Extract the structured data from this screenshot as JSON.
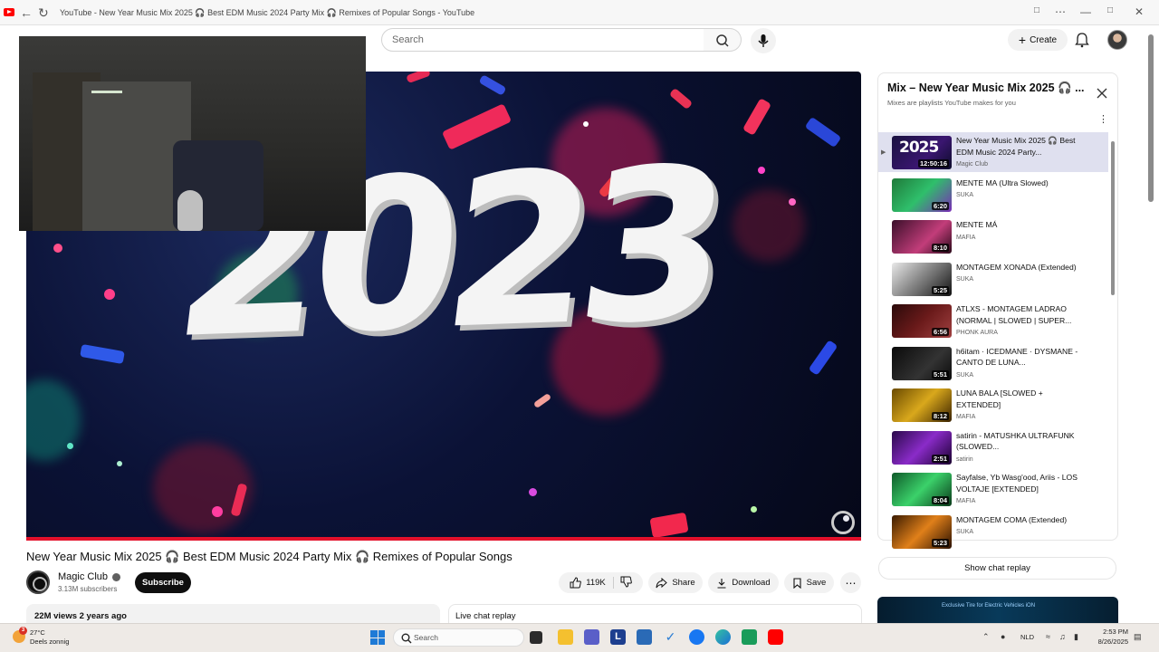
{
  "browser": {
    "tab_title": "YouTube - New Year Music Mix 2025 🎧 Best EDM Music 2024 Party Mix 🎧 Remixes of Popular Songs - YouTube"
  },
  "header": {
    "search_placeholder": "Search",
    "create_label": "Create"
  },
  "player": {
    "overlay_text": "2023",
    "progress": 1.0
  },
  "video": {
    "title": "New Year Music Mix 2025 🎧 Best EDM Music 2024 Party Mix 🎧 Remixes of Popular Songs",
    "channel": "Magic Club",
    "subscribers": "3.13M subscribers",
    "subscribe_label": "Subscribe",
    "likes": "119K",
    "share_label": "Share",
    "download_label": "Download",
    "save_label": "Save",
    "views_date": "22M views  2 years ago",
    "live_chat_label": "Live chat replay"
  },
  "playlist": {
    "title": "Mix – New Year Music Mix 2025 🎧 ...",
    "subtitle": "Mixes are playlists YouTube makes for you",
    "items": [
      {
        "title": "New Year Music Mix 2025 🎧 Best EDM Music 2024 Party...",
        "channel": "Magic Club",
        "duration": "12:50:16",
        "thumb": "2025",
        "active": true
      },
      {
        "title": "MENTE MA (Ultra Slowed)",
        "channel": "SUKA",
        "duration": "6:20"
      },
      {
        "title": "MENTE MÁ",
        "channel": "MAFIA",
        "duration": "8:10"
      },
      {
        "title": "MONTAGEM XONADA (Extended)",
        "channel": "SUKA",
        "duration": "5:25"
      },
      {
        "title": "ATLXS - MONTAGEM LADRAO (NORMAL | SLOWED | SUPER...",
        "channel": "PHONK AURA",
        "duration": "6:56"
      },
      {
        "title": "h6itam · ICEDMANE · DYSMANE - CANTO DE LUNA...",
        "channel": "SUKA",
        "duration": "5:51"
      },
      {
        "title": "LUNA BALA [SLOWED + EXTENDED]",
        "channel": "MAFIA",
        "duration": "8:12"
      },
      {
        "title": "satirin - MATUSHKA ULTRAFUNK (SLOWED...",
        "channel": "satirin",
        "duration": "2:51"
      },
      {
        "title": "Sayfalse, Yb Wasg'ood, Ariis - LOS VOLTAJE [EXTENDED]",
        "channel": "MAFIA",
        "duration": "8:04"
      },
      {
        "title": "MONTAGEM COMA (Extended)",
        "channel": "SUKA",
        "duration": "5:23"
      }
    ],
    "show_chat_label": "Show chat replay",
    "ad_text": "Exclusive Tire for Electric Vehicles iON"
  },
  "taskbar": {
    "weather_badge": "3",
    "temperature": "27°C",
    "weather_desc": "Deels zonnig",
    "search_label": "Search",
    "language": "NLD",
    "time": "2:53 PM",
    "date": "8/26/2025"
  },
  "colors": {
    "accent_red": "#e3102b",
    "subscribe_bg": "#0f0f0f",
    "active_row": "#dfe0ef"
  }
}
